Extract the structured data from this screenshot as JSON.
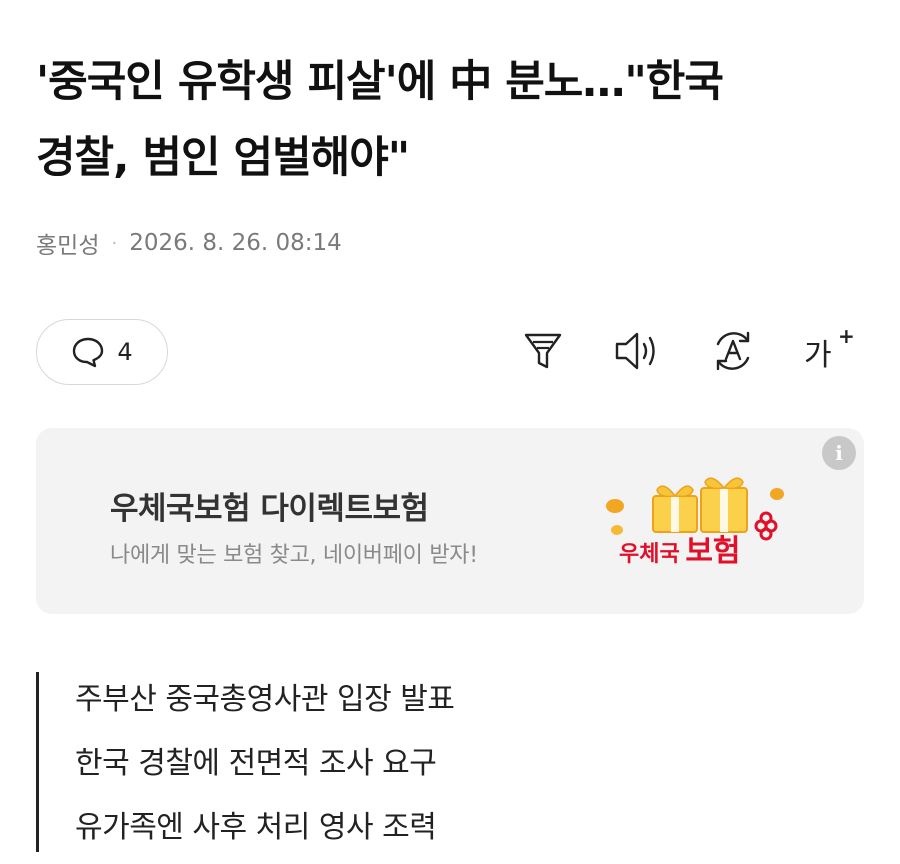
{
  "article": {
    "title_line1": "'중국인 유학생 피살'에 中 분노…\"한국",
    "title_line2": "경찰, 범인 엄벌해야\"",
    "author": "홍민성",
    "separator": "·",
    "datetime": "2026. 8. 26. 08:14"
  },
  "toolbar": {
    "comment_count": "4",
    "font_size_label": "가",
    "font_size_plus": "+",
    "icons": [
      "comment-icon",
      "summary-filter-icon",
      "speaker-icon",
      "translate-icon",
      "font-size-icon"
    ]
  },
  "ad": {
    "title": "우체국보험 다이렉트보험",
    "subtitle": "나에게 맞는 보험 찾고, 네이버페이 받자!",
    "info_label": "i",
    "logo_text_small": "우체국",
    "logo_text_big": "보험",
    "colors": {
      "logo_red": "#e0102a",
      "gift_gold": "#f2a623"
    }
  },
  "summary": {
    "lines": [
      "주부산 중국총영사관 입장 발표",
      "한국 경찰에 전면적 조사 요구",
      "유가족엔 사후 처리 영사 조력"
    ]
  }
}
